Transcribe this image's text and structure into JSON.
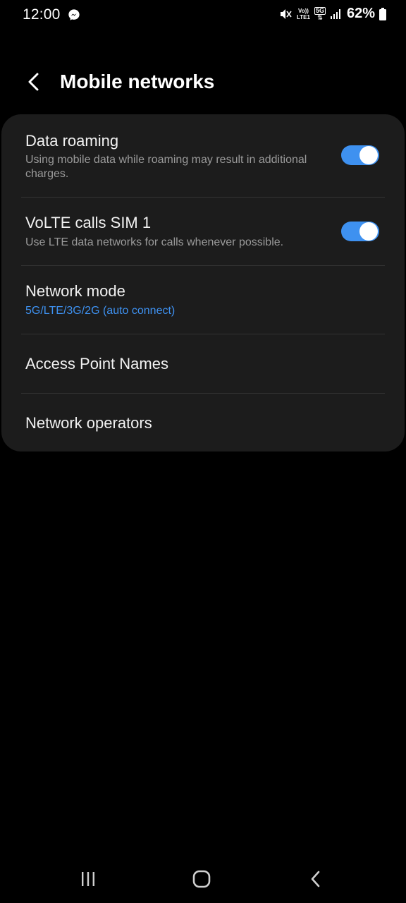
{
  "status_bar": {
    "time": "12:00",
    "notification_icon": "messenger-icon",
    "volte_label_top": "Vo))",
    "volte_label_bottom": "LTE1",
    "network_label": "5G",
    "battery_percent": "62%"
  },
  "header": {
    "back_icon": "back-arrow-icon",
    "title": "Mobile networks"
  },
  "settings": {
    "data_roaming": {
      "title": "Data roaming",
      "subtitle": "Using mobile data while roaming may result in additional charges.",
      "enabled": true
    },
    "volte": {
      "title": "VoLTE calls SIM 1",
      "subtitle": "Use LTE data networks for calls whenever possible.",
      "enabled": true
    },
    "network_mode": {
      "title": "Network mode",
      "value": "5G/LTE/3G/2G (auto connect)"
    },
    "apn": {
      "title": "Access Point Names"
    },
    "operators": {
      "title": "Network operators"
    }
  },
  "colors": {
    "accent": "#3e91f0",
    "card_background": "#1c1c1c",
    "page_background": "#000000",
    "secondary_text": "#9a9a9a"
  },
  "nav_bar": {
    "recents_icon": "recents-icon",
    "home_icon": "home-icon",
    "back_icon": "nav-back-icon"
  }
}
